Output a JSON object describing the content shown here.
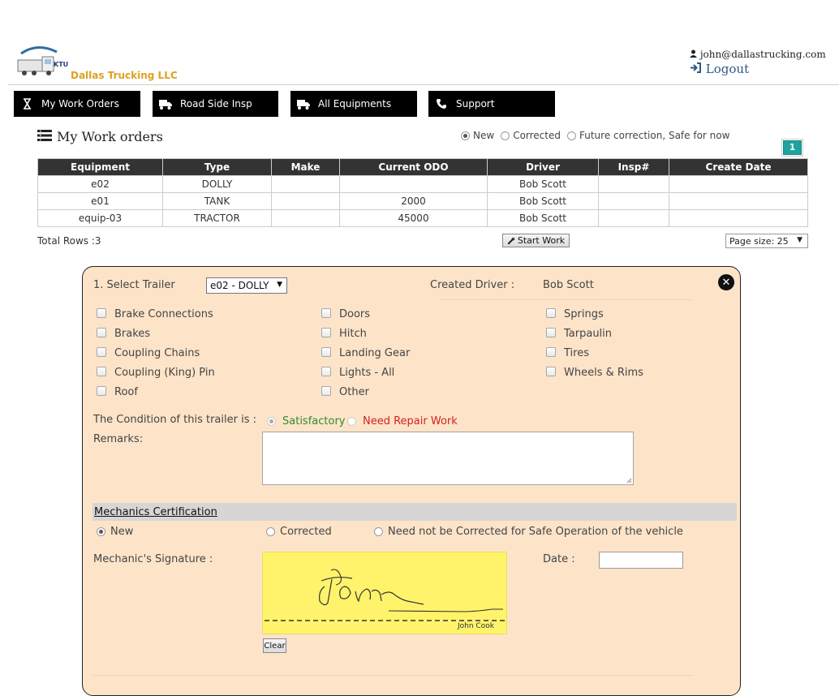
{
  "header": {
    "brand": "Dallas Trucking LLC",
    "logo_text": "KTU",
    "user_email": "john@dallastrucking.com",
    "logout_label": "Logout"
  },
  "nav": [
    {
      "label": "My Work Orders",
      "icon": "hourglass-icon"
    },
    {
      "label": "Road Side Insp",
      "icon": "truck-icon"
    },
    {
      "label": "All Equipments",
      "icon": "truck-icon"
    },
    {
      "label": "Support",
      "icon": "phone-icon"
    }
  ],
  "work_orders": {
    "title": "My Work orders",
    "filters": [
      {
        "label": "New",
        "selected": true
      },
      {
        "label": "Corrected",
        "selected": false
      },
      {
        "label": "Future correction, Safe for now",
        "selected": false
      }
    ],
    "page_number": "1",
    "columns": [
      "Equipment",
      "Type",
      "Make",
      "Current ODO",
      "Driver",
      "Insp#",
      "Create Date"
    ],
    "rows": [
      [
        "e02",
        "DOLLY",
        "",
        "",
        "Bob Scott",
        "",
        ""
      ],
      [
        "e01",
        "TANK",
        "",
        "2000",
        "Bob Scott",
        "",
        ""
      ],
      [
        "equip-03",
        "TRACTOR",
        "",
        "45000",
        "Bob Scott",
        "",
        ""
      ]
    ],
    "total_rows": "Total Rows :3",
    "start_work_label": "Start Work",
    "page_size_label": "Page size: 25"
  },
  "inspection": {
    "select_trailer_label": "1. Select Trailer",
    "selected_trailer": "e02 - DOLLY",
    "created_driver_label": "Created Driver :",
    "created_driver": "Bob Scott",
    "checklist": [
      [
        "Brake Connections",
        "Brakes",
        "Coupling Chains",
        "Coupling (King) Pin",
        "Roof"
      ],
      [
        "Doors",
        "Hitch",
        "Landing Gear",
        "Lights - All",
        "Other"
      ],
      [
        "Springs",
        "Tarpaulin",
        "Tires",
        "Wheels & Rims"
      ]
    ],
    "condition_label": "The Condition of this trailer is :",
    "condition_ok": "Satisfactory",
    "condition_repair": "Need Repair Work",
    "remarks_label": "Remarks:",
    "cert_title": "Mechanics Certification",
    "cert_options": [
      "New",
      "Corrected",
      "Need not be Corrected for Safe Operation of the vehicle"
    ],
    "signature_label": "Mechanic's Signature :",
    "signature_name": "John Cook",
    "date_label": "Date :",
    "clear_label": "Clear"
  },
  "colors": {
    "nav_bg": "#000000",
    "panel_bg": "#fde4c9",
    "table_header": "#333333",
    "brand": "#e0a120",
    "pager": "#1fa3a0",
    "ok_text": "#2e8b2e",
    "repair_text": "#d42020",
    "signature_pad": "#fff36b"
  }
}
